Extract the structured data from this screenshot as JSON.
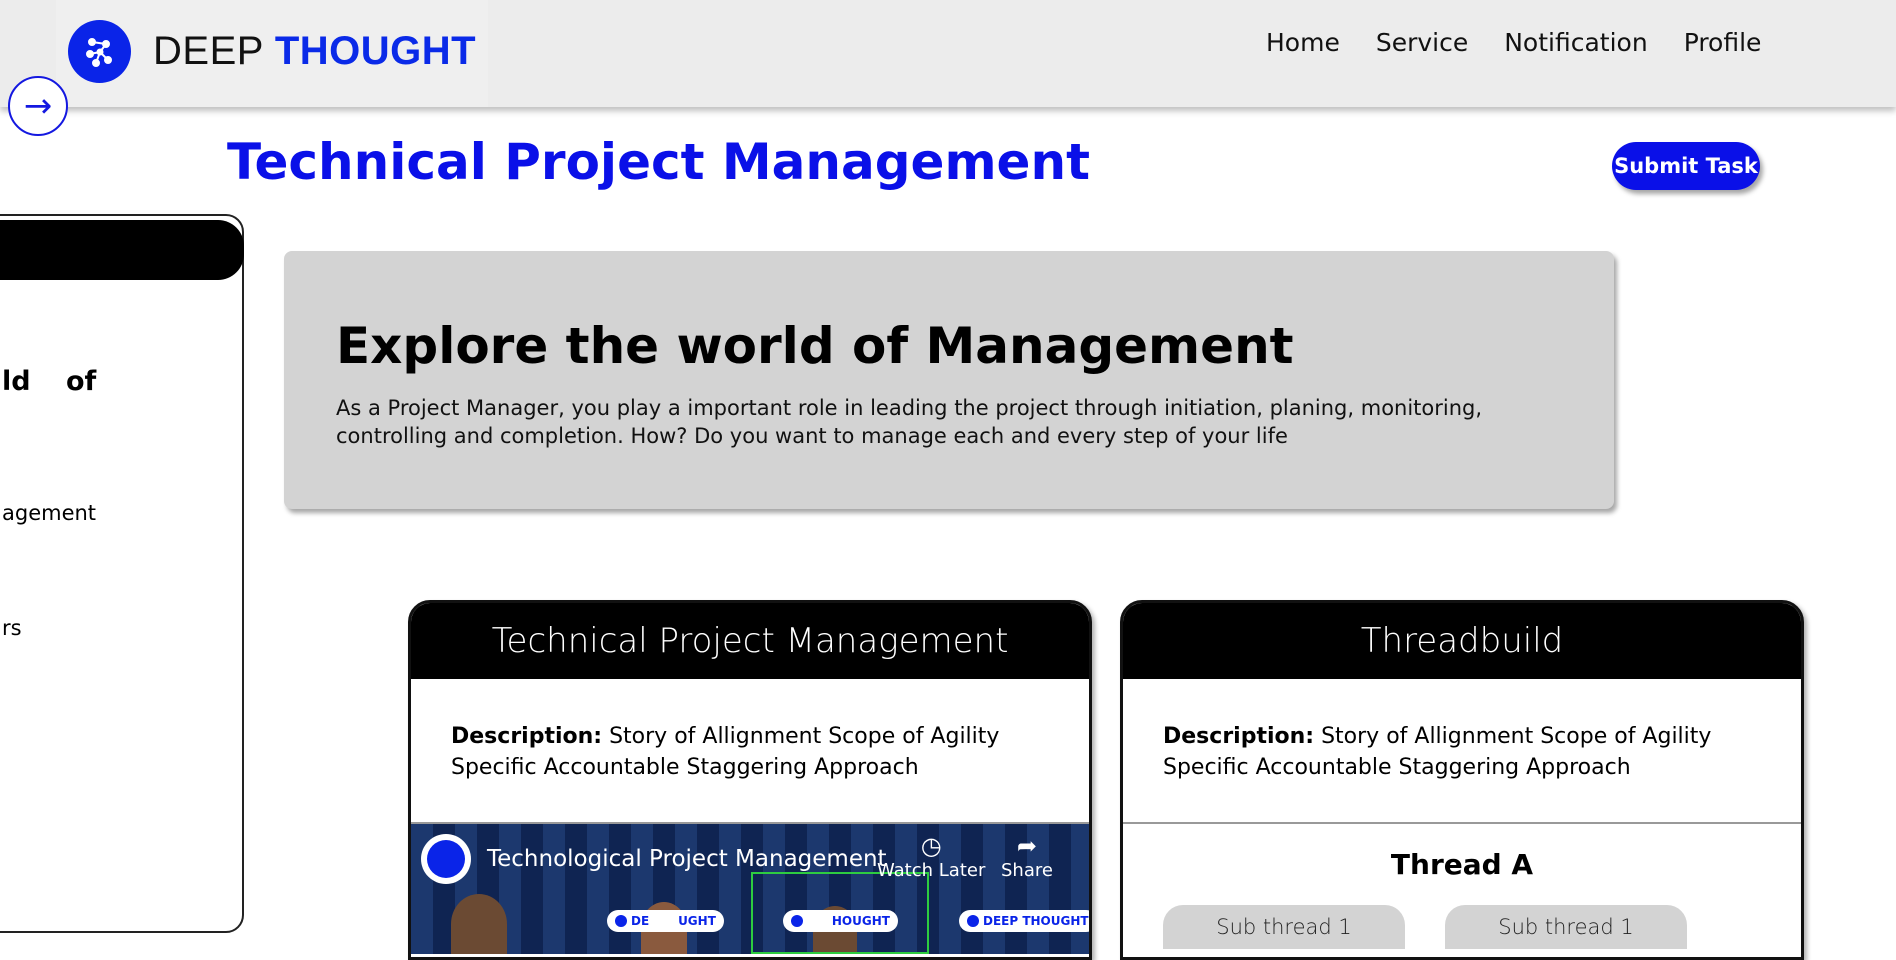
{
  "brand": {
    "light": "DEEP",
    "bold": "THOUGHT"
  },
  "nav": {
    "items": [
      "Home",
      "Service",
      "Notification",
      "Profile"
    ]
  },
  "page": {
    "title": "Technical Project Management",
    "submit_label": "Submit Task"
  },
  "sidebar": {
    "heading": "ld of",
    "item1": "agement",
    "item2": "rs"
  },
  "explore": {
    "heading": "Explore the world of Management",
    "body": "As a Project Manager, you play a important role in leading the project through initiation, planing, monitoring, controlling and completion. How? Do you want to manage each and every step of your life"
  },
  "cards": [
    {
      "title": "Technical Project Management",
      "desc_label": "Description:",
      "desc_text": " Story of Allignment Scope of Agility Specific Accountable Staggering Approach",
      "video": {
        "title": "Technological Project Management",
        "watch_later": "Watch Later",
        "share": "Share",
        "badges": [
          "DE",
          "UGHT",
          "HOUGHT",
          "DEEP THOUGHT"
        ]
      }
    },
    {
      "title": "Threadbuild",
      "desc_label": "Description:",
      "desc_text": " Story of Allignment Scope of Agility Specific Accountable Staggering Approach",
      "thread_title": "Thread A",
      "sub_threads": [
        "Sub thread 1",
        "Sub thread 1"
      ]
    }
  ],
  "colors": {
    "accent": "#0a10e8",
    "panel": "#d3d3d3",
    "nav_bg": "#ececec"
  },
  "icons": {
    "logo": "network-nodes-icon",
    "side_toggle": "arrow-right-icon",
    "clock": "clock-icon",
    "share": "share-arrow-icon"
  }
}
